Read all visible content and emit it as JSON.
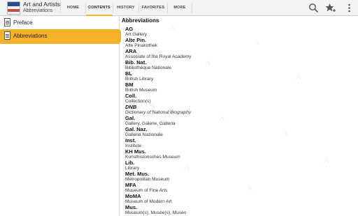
{
  "header": {
    "app_title": "Art and Artists",
    "app_subtitle": "Abbreviations",
    "app_icon": "book-cover-icon",
    "tabs": [
      {
        "label": "HOME"
      },
      {
        "label": "CONTENTS",
        "active": true
      },
      {
        "label": "HISTORY"
      },
      {
        "label": "FAVORITES"
      },
      {
        "label": "MORE"
      }
    ],
    "actions": [
      "search-icon",
      "star-add-icon",
      "overflow-menu-icon"
    ]
  },
  "sidebar": {
    "items": [
      {
        "label": "Preface",
        "icon": "document-icon"
      },
      {
        "label": "Abbreviations",
        "icon": "document-icon",
        "active": true
      }
    ]
  },
  "content": {
    "title": "Abbreviations",
    "entries": [
      {
        "abbr": "AG",
        "full": "Art Gallery"
      },
      {
        "abbr": "Alte Pin.",
        "full": "Alte Pinakothek"
      },
      {
        "abbr": "ARA",
        "full": "Associate of the Royal Academy"
      },
      {
        "abbr": "Bib. Nat.",
        "full": "Bibliothèque Nationale"
      },
      {
        "abbr": "BL",
        "full": "British Library"
      },
      {
        "abbr": "BM",
        "full": "British Museum"
      },
      {
        "abbr": "Coll.",
        "full": "Collection(s)"
      },
      {
        "abbr": "DNB",
        "full": "Dictionary of National Biography",
        "italic": true
      },
      {
        "abbr": "Gal.",
        "full": "Gallery, Galerie, Galleria"
      },
      {
        "abbr": "Gal. Naz.",
        "full": "Galleria Nazionale"
      },
      {
        "abbr": "Inst.",
        "full": "Institute"
      },
      {
        "abbr": "KH Mus.",
        "full": "Kunsthistorisches Museum"
      },
      {
        "abbr": "Lib.",
        "full": "Library"
      },
      {
        "abbr": "Met. Mus.",
        "full": "Metropolitan Museum"
      },
      {
        "abbr": "MFA",
        "full": "Museum of Fine Arts"
      },
      {
        "abbr": "MoMA",
        "full": "Museum of Modern Art"
      },
      {
        "abbr": "Mus.",
        "full": "Museum(s), Musée(s), Museo"
      }
    ]
  },
  "colors": {
    "accent": "#f6b12a",
    "topbar": "#f3f3f3",
    "text": "#222222"
  }
}
